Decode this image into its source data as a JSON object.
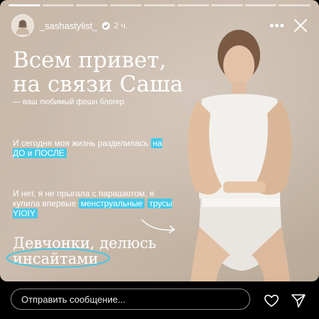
{
  "story": {
    "progress_segments": 9,
    "progress_done": 1
  },
  "header": {
    "handle": "_sashastylist_",
    "time": "2 ч.",
    "more_icon": "more-horizontal-icon",
    "close_icon": "close-icon"
  },
  "content": {
    "title_line1": "Всем привет,",
    "title_line2": "на связи Саша",
    "subtitle": "— ваш любимый фешн блогер",
    "p1_text": "И сегодня моя жизнь разделилась",
    "p1_highlight": "на ДО и ПОСЛЕ",
    "p2_text": "И нет, я не прыгала с парашютом, я купила впервые",
    "p2_highlight1": "менструальные",
    "p2_highlight2": "трусы YIOIY",
    "bottom_line1": "Девчонки, делюсь",
    "bottom_line2": "инсайтами",
    "accent_color": "#45c9e8"
  },
  "footer": {
    "reply_placeholder": "Отправить сообщение...",
    "heart_icon": "heart-icon",
    "send_icon": "send-icon"
  }
}
